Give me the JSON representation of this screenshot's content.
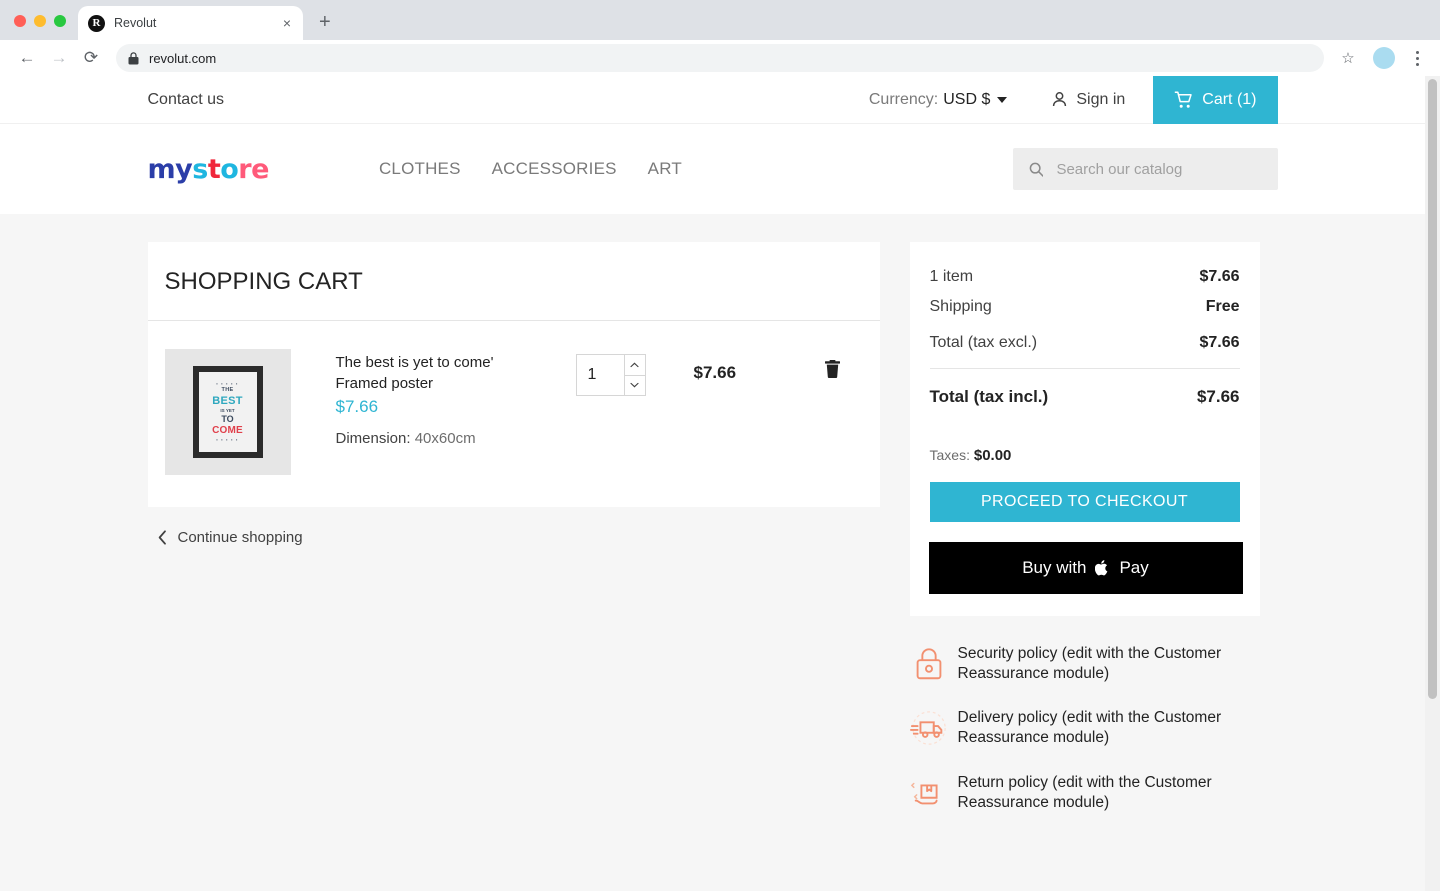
{
  "browser": {
    "tab": {
      "title": "Revolut",
      "favicon_letter": "R",
      "favicon_name": "revolut-favicon"
    },
    "newtab_label": "+",
    "close_label": "×",
    "url": "revolut.com",
    "back_label": "←",
    "forward_label": "→",
    "reload_label": "⟳",
    "lock_label": "🔒",
    "star_label": "☆"
  },
  "topbar": {
    "contact_us": "Contact us",
    "currency_label": "Currency:",
    "currency_value": "USD $",
    "sign_in": "Sign in",
    "cart": "Cart (1)"
  },
  "header": {
    "logo": {
      "part1": "my",
      "part2": "s",
      "part3": "t",
      "part4": "o",
      "part5": "re"
    },
    "nav": [
      {
        "label": "CLOTHES"
      },
      {
        "label": "ACCESSORIES"
      },
      {
        "label": "ART"
      }
    ],
    "search_placeholder": "Search our catalog",
    "search_value": ""
  },
  "cart": {
    "title": "SHOPPING CART",
    "item": {
      "name": "The best is yet to come'",
      "name_line2": "Framed poster",
      "unit_price": "$7.66",
      "attribute_label": "Dimension:",
      "attribute_value": "40x60cm",
      "quantity": "1",
      "line_total": "$7.66",
      "poster": {
        "dots_top": "▪ ▪ ▪ ▪ ▪",
        "the": "THE",
        "best": "BEST",
        "yet": "IS YET",
        "to": "TO",
        "come": "COME",
        "dots_bottom": "▪ ▪ ▪ ▪ ▪"
      }
    },
    "continue_shopping": "Continue shopping"
  },
  "summary": {
    "rows": [
      {
        "label": "1 item",
        "value": "$7.66"
      },
      {
        "label": "Shipping",
        "value": "Free"
      },
      {
        "label": "Total (tax excl.)",
        "value": "$7.66"
      }
    ],
    "total_label": "Total (tax incl.)",
    "total_value": "$7.66",
    "taxes_label": "Taxes:",
    "taxes_value": "$0.00",
    "checkout_label": "PROCEED TO CHECKOUT",
    "applepay_prefix": "Buy with",
    "applepay_glyph": "",
    "applepay_label": "Pay"
  },
  "policies": [
    {
      "title": "Security policy",
      "sub": "(edit with the Customer Reassurance module)",
      "icon": "lock-icon"
    },
    {
      "title": "Delivery policy",
      "sub": "(edit with the Customer Reassurance module)",
      "icon": "truck-icon"
    },
    {
      "title": "Return policy",
      "sub": "(edit with the Customer Reassurance module)",
      "icon": "return-box-icon"
    }
  ],
  "colors": {
    "accent": "#2fb5d2",
    "policy_icon": "#f29070",
    "page_bg": "#f6f6f6"
  }
}
